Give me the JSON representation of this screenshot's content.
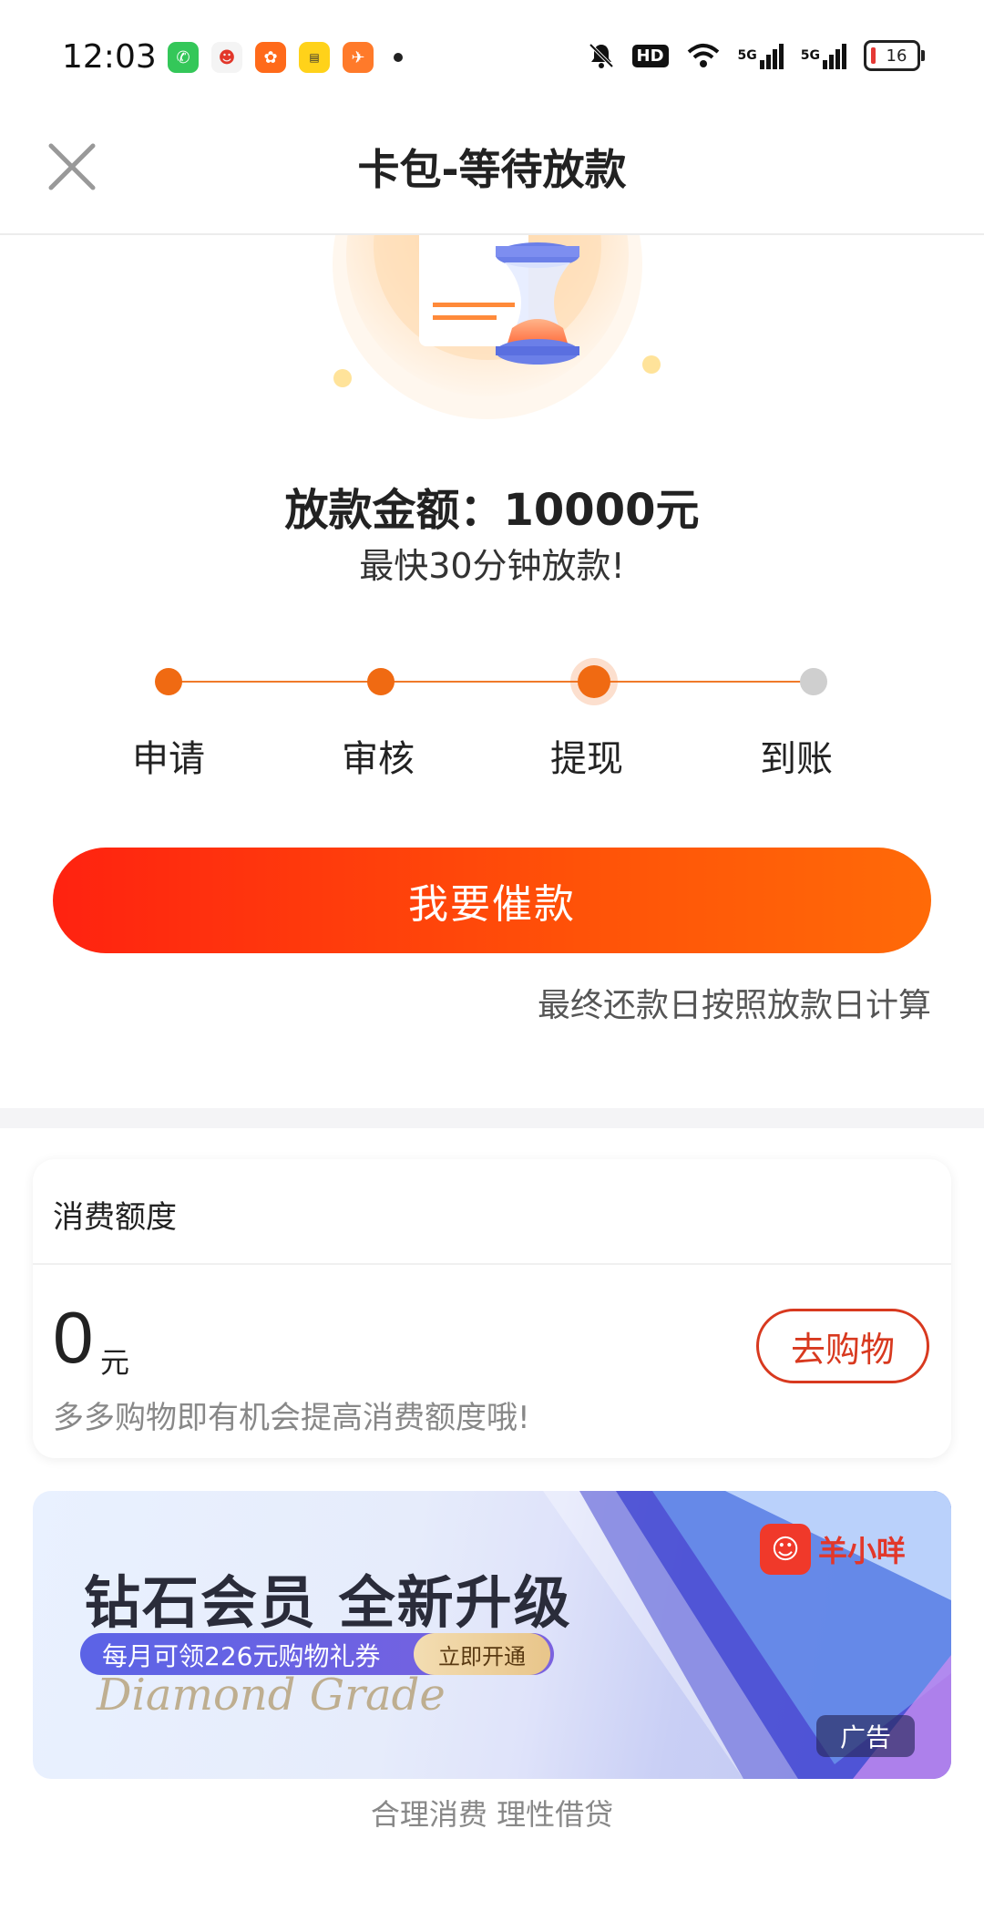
{
  "status_bar": {
    "time": "12:03",
    "app_icons": [
      "phone-app-icon",
      "sheep-app-icon",
      "store-app-icon",
      "yellow-app-icon",
      "delivery-app-icon"
    ],
    "signal_labels": [
      "HD",
      "5G",
      "5G"
    ],
    "battery": "16"
  },
  "header": {
    "title": "卡包-等待放款"
  },
  "loan": {
    "amount_text": "放款金额：10000元",
    "speed_text": "最快30分钟放款!"
  },
  "steps": [
    {
      "label": "申请",
      "state": "done"
    },
    {
      "label": "审核",
      "state": "done"
    },
    {
      "label": "提现",
      "state": "active"
    },
    {
      "label": "到账",
      "state": "pending"
    }
  ],
  "actions": {
    "urge_label": "我要催款",
    "repay_note": "最终还款日按照放款日计算"
  },
  "credit": {
    "title": "消费额度",
    "amount": "0",
    "unit": "元",
    "hint": "多多购物即有机会提高消费额度哦!",
    "shop_label": "去购物"
  },
  "banner": {
    "headline": "钻石会员  全新升级",
    "offer": "每月可领226元购物礼券",
    "cta": "立即开通",
    "script_text": "Diamond Grade",
    "brand_name": "羊小咩",
    "ad_label": "广告"
  },
  "footer": {
    "slogan": "合理消费 理性借贷"
  },
  "colors": {
    "accent": "#f06a12",
    "button_start": "#ff2210",
    "button_end": "#ff6a08",
    "shop_border": "#d8391f"
  }
}
